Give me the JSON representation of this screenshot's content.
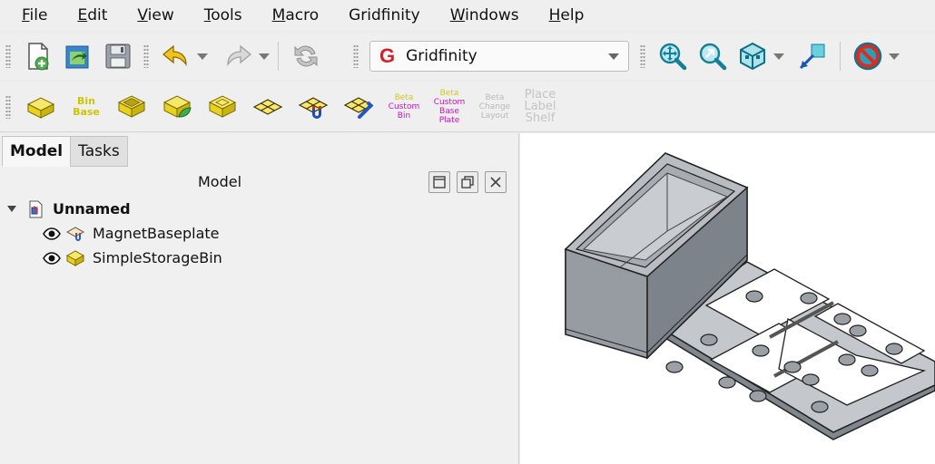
{
  "menu": {
    "items": [
      {
        "ul": "F",
        "rest": "ile"
      },
      {
        "ul": "E",
        "rest": "dit"
      },
      {
        "ul": "V",
        "rest": "iew"
      },
      {
        "ul": "T",
        "rest": "ools"
      },
      {
        "ul": "M",
        "rest": "acro"
      },
      {
        "ul": "",
        "rest": "Gridfinity"
      },
      {
        "ul": "W",
        "rest": "indows"
      },
      {
        "ul": "H",
        "rest": "elp"
      }
    ]
  },
  "toolbar": {
    "workbench_letter": "G",
    "workbench": "Gridfinity"
  },
  "gridfinity_tools": {
    "bin_base": {
      "line1": "Bin",
      "line2": "Base"
    },
    "beta_custom_bin": {
      "beta": "Beta",
      "line1": "Custom",
      "line2": "Bin"
    },
    "beta_custom_base_plate": {
      "beta": "Beta",
      "line1": "Custom",
      "line2": "Base",
      "line3": "Plate"
    },
    "beta_change_layout": {
      "beta": "Beta",
      "line1": "Change",
      "line2": "Layout"
    },
    "place_label_shelf": {
      "line1": "Place",
      "line2": "Label",
      "line3": "Shelf"
    }
  },
  "panel": {
    "tabs": {
      "model": "Model",
      "tasks": "Tasks"
    },
    "title": "Model",
    "tree": {
      "root": "Unnamed",
      "children": [
        "MagnetBaseplate",
        "SimpleStorageBin"
      ]
    }
  },
  "colors": {
    "accent_red": "#d81f26",
    "bin_yellow": "#e8d21e",
    "model_grey": "#8c9298"
  }
}
